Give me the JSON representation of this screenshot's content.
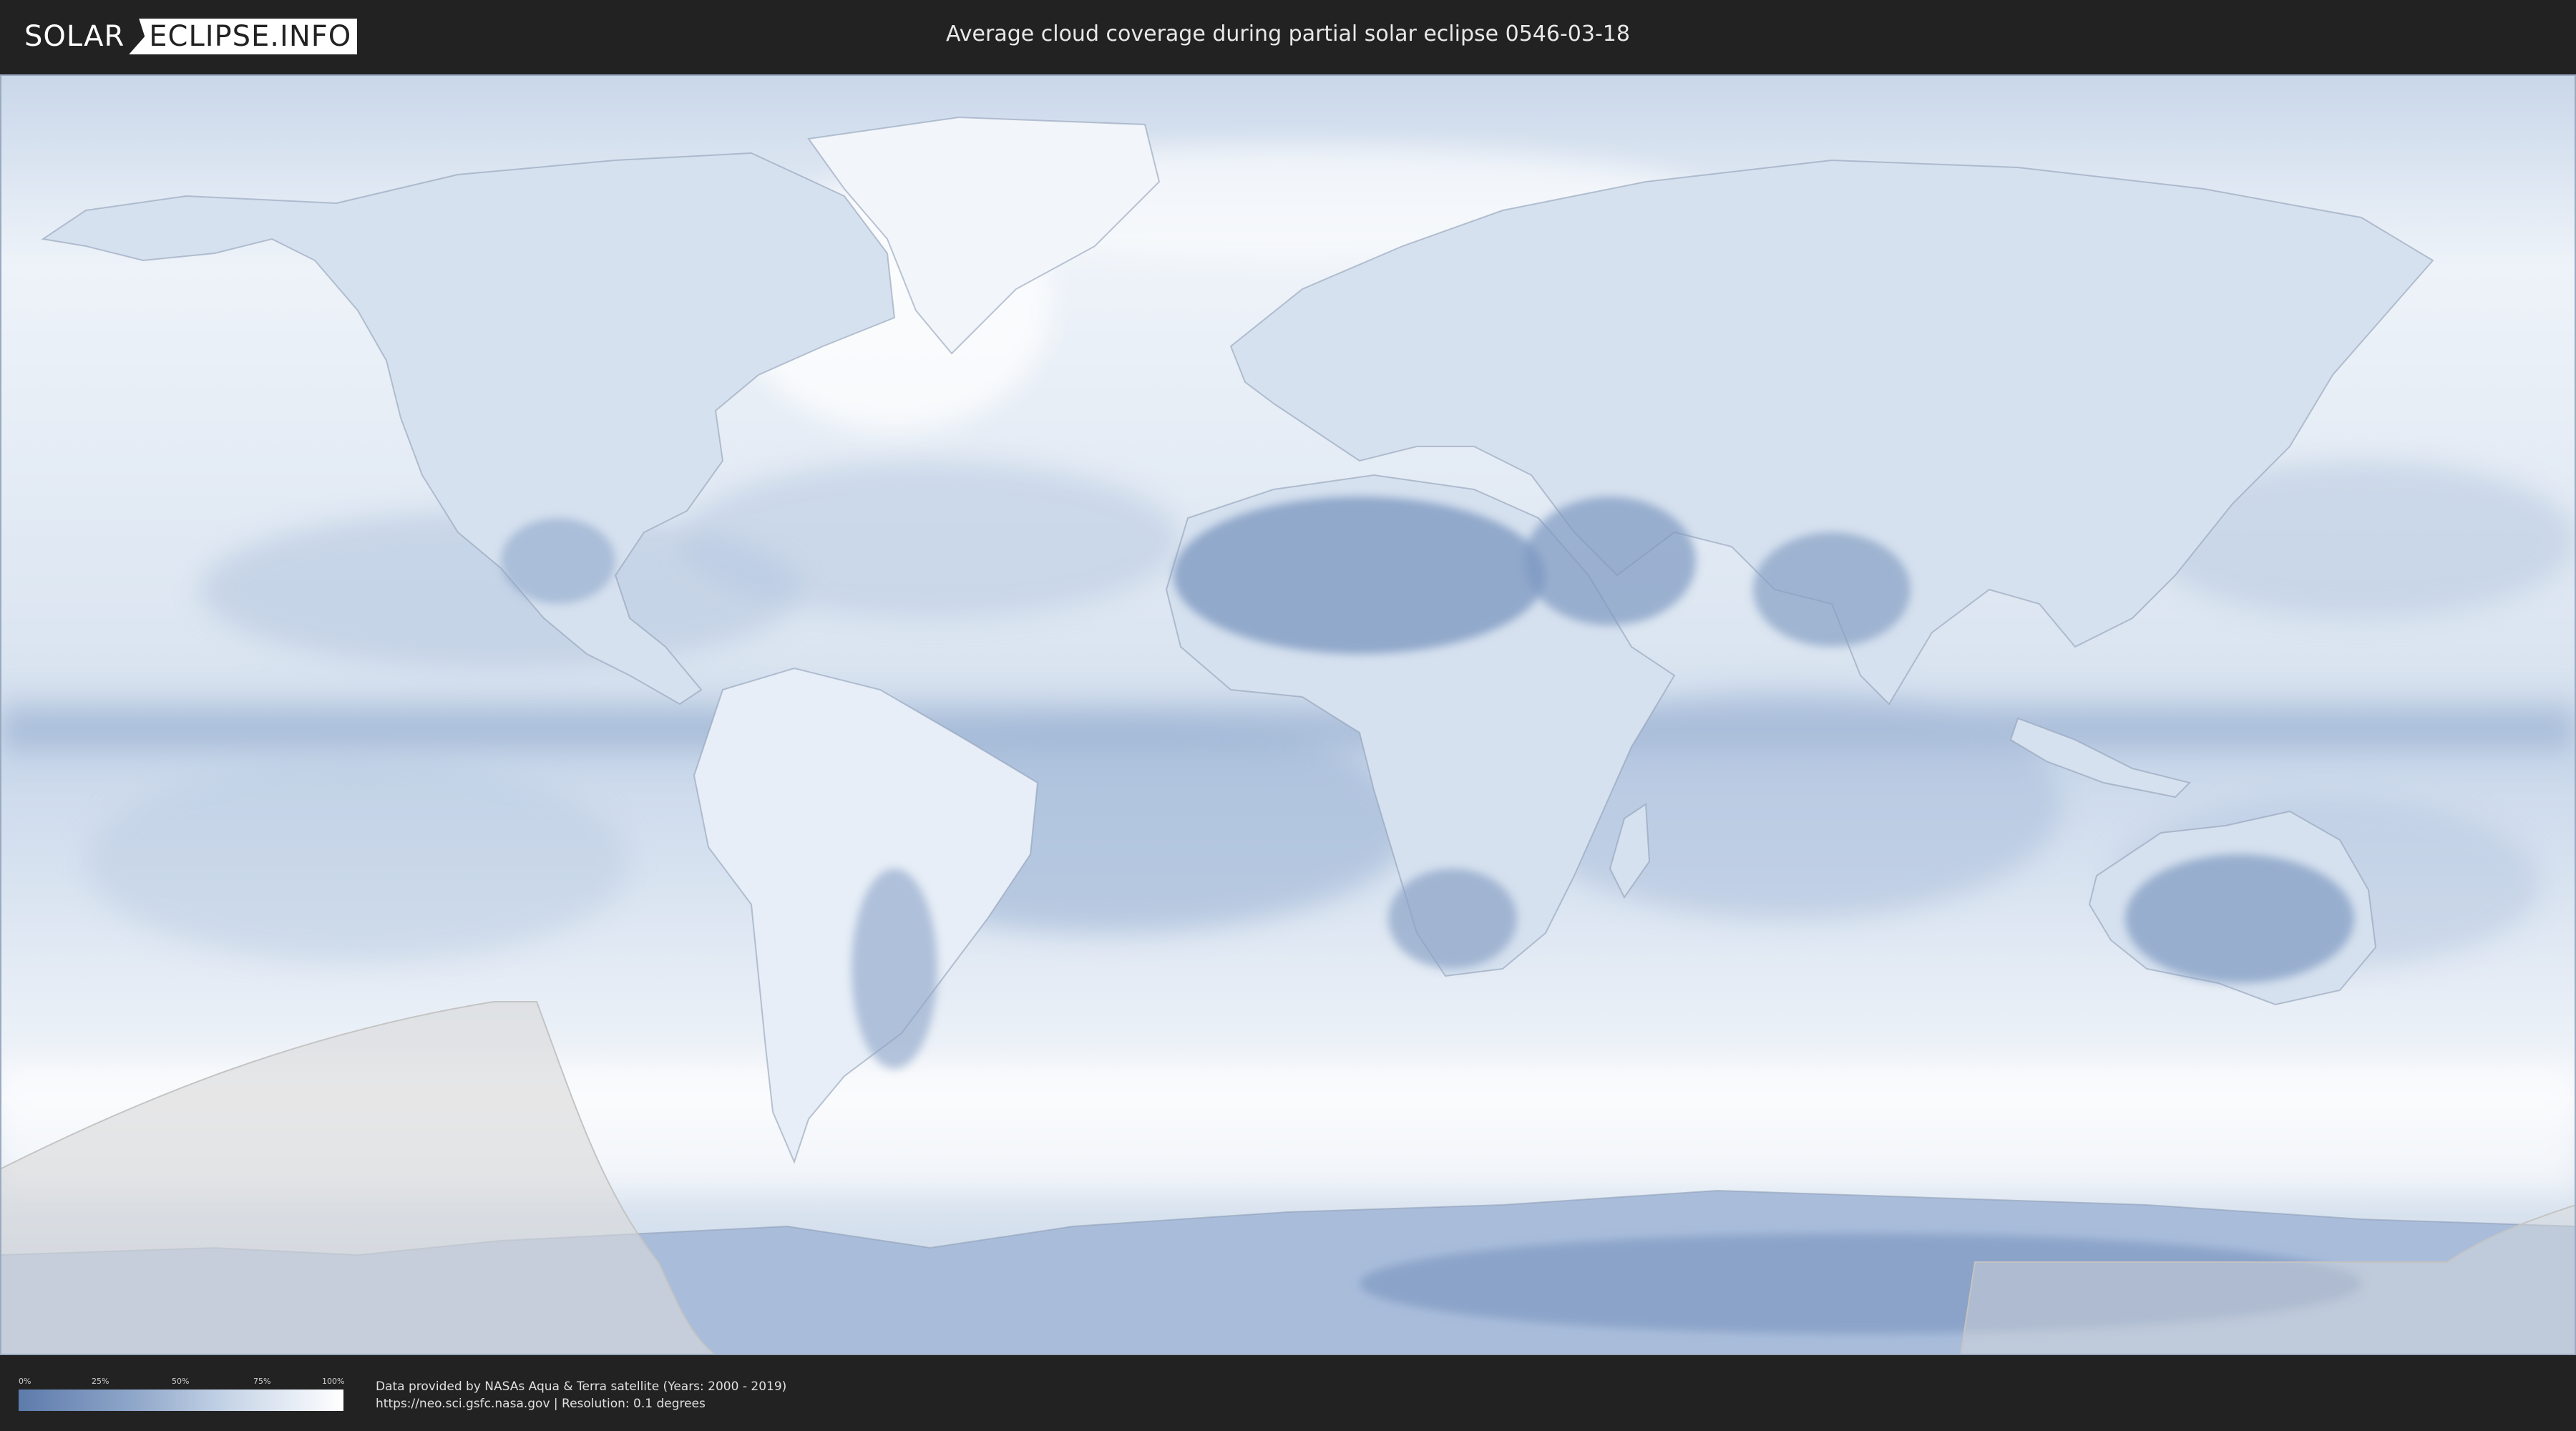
{
  "logo": {
    "left_text": "SOLAR",
    "right_text": "ECLIPSE.INFO"
  },
  "header": {
    "title": "Average cloud coverage during partial solar eclipse 0546-03-18"
  },
  "map": {
    "eclipse_zone_color": "#d9d9d9",
    "ocean_cloud_color": "#dfe8f3",
    "clear_sky_color": "#5d7bab"
  },
  "legend": {
    "ticks": [
      "0%",
      "25%",
      "50%",
      "75%",
      "100%"
    ],
    "gradient_start": "#5d7bab",
    "gradient_end": "#ffffff"
  },
  "credits": {
    "line1": "Data provided by NASAs Aqua & Terra satellite (Years: 2000 - 2019)",
    "line2": "https://neo.sci.gsfc.nasa.gov | Resolution: 0.1 degrees"
  }
}
